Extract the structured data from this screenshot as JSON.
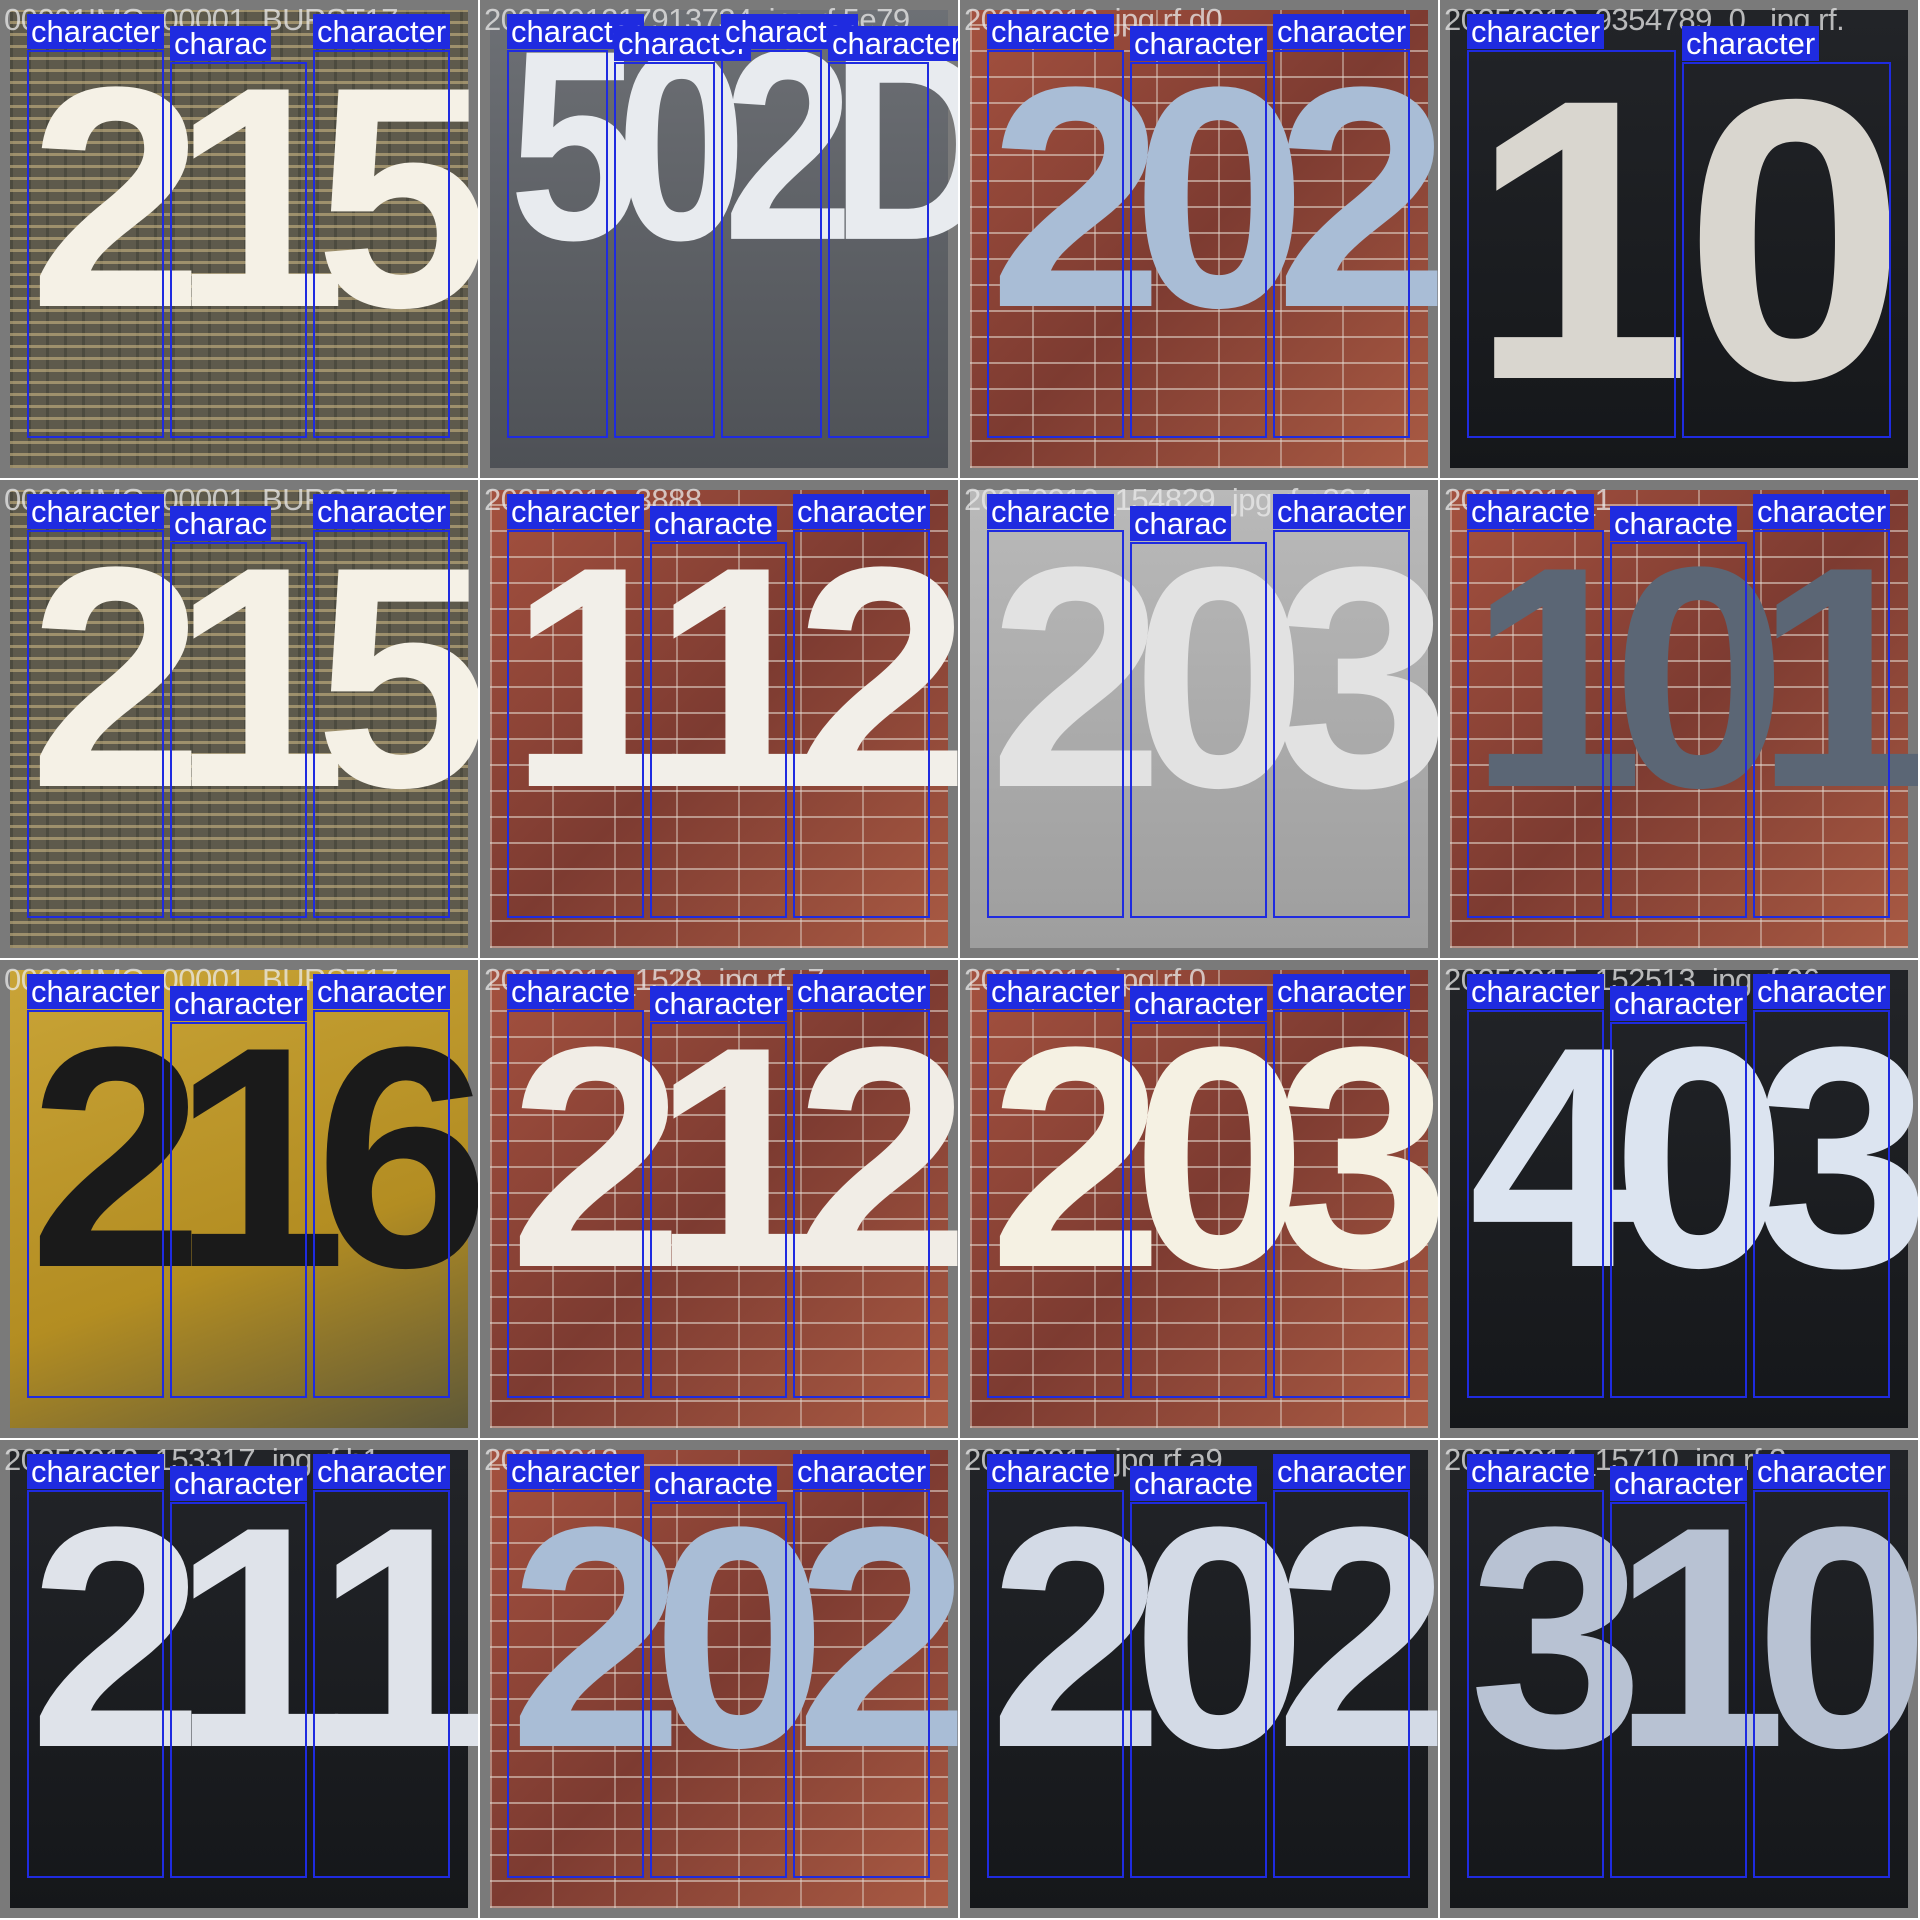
{
  "grid": {
    "columns": 4,
    "rows": 4,
    "box_color": "#1f2be0",
    "label_text": "character"
  },
  "tiles": [
    {
      "filename": "00001IMG_00001_BURST17",
      "digits": [
        "2",
        "1",
        "5"
      ],
      "background": "grille",
      "digit_color": "#f5f1e6",
      "labels": [
        "character",
        "charac",
        "character"
      ]
    },
    {
      "filename": "2025091217913734_jpg.rf.5e79",
      "digits": [
        "5",
        "0",
        "2",
        "D"
      ],
      "background": "glass",
      "digit_color": "#e8ebef",
      "labels": [
        "character",
        "character",
        "character",
        "character"
      ]
    },
    {
      "filename": "20250912_jpg.rf.d0",
      "digits": [
        "2",
        "0",
        "2"
      ],
      "background": "brick",
      "digit_color": "#a9bdd6",
      "labels": [
        "characte",
        "character",
        "character"
      ]
    },
    {
      "filename": "20250912_9354789_0_.jpg.rf.",
      "digits": [
        "1",
        "0"
      ],
      "background": "dark",
      "digit_color": "#d9d6cf",
      "labels": [
        "character",
        "character"
      ]
    },
    {
      "filename": "00001IMG_00001_BURST17",
      "digits": [
        "2",
        "1",
        "5"
      ],
      "background": "grille",
      "digit_color": "#f5f1e6",
      "labels": [
        "character",
        "charac",
        "character"
      ]
    },
    {
      "filename": "20250912_3888",
      "digits": [
        "1",
        "1",
        "2"
      ],
      "background": "brick",
      "digit_color": "#f2efe9",
      "labels": [
        "character",
        "characte",
        "character"
      ]
    },
    {
      "filename": "20250912_154829_jpg.rf.e394",
      "digits": [
        "2",
        "0",
        "3"
      ],
      "background": "fog",
      "digit_color": "#e2e2e2",
      "labels": [
        "characte",
        "charac",
        "character"
      ]
    },
    {
      "filename": "20250912_1",
      "digits": [
        "1",
        "0",
        "1"
      ],
      "background": "brick",
      "digit_color": "#5b6675",
      "labels": [
        "characte",
        "characte",
        "character"
      ]
    },
    {
      "filename": "00001IMG_00001_BURST17",
      "digits": [
        "2",
        "1",
        "6"
      ],
      "background": "yellow",
      "digit_color": "#1a1a1a",
      "labels": [
        "character",
        "character",
        "character"
      ]
    },
    {
      "filename": "20250912_1528_jpg.rf.c7",
      "digits": [
        "2",
        "1",
        "2"
      ],
      "background": "brick",
      "digit_color": "#f1ede6",
      "labels": [
        "characte",
        "character",
        "character"
      ]
    },
    {
      "filename": "20250912_jpg.rf.0",
      "digits": [
        "2",
        "0",
        "3"
      ],
      "background": "brick",
      "digit_color": "#f5f1e3",
      "labels": [
        "character",
        "character",
        "character"
      ]
    },
    {
      "filename": "20250915_152513_jpg.rf.06",
      "digits": [
        "4",
        "0",
        "3"
      ],
      "background": "dark",
      "digit_color": "#dce4f0",
      "labels": [
        "character",
        "character",
        "character"
      ]
    },
    {
      "filename": "20250912_153317_jpg.rf.b1",
      "digits": [
        "2",
        "1",
        "1"
      ],
      "background": "dark",
      "digit_color": "#dfe3ea",
      "labels": [
        "character",
        "character",
        "character"
      ]
    },
    {
      "filename": "20250912",
      "digits": [
        "2",
        "0",
        "2"
      ],
      "background": "brick",
      "digit_color": "#a9bdd6",
      "labels": [
        "character",
        "characte",
        "character"
      ]
    },
    {
      "filename": "20250915_jpg.rf.a9",
      "digits": [
        "2",
        "0",
        "2"
      ],
      "background": "dark",
      "digit_color": "#d3dae6",
      "labels": [
        "characte",
        "characte",
        "character"
      ]
    },
    {
      "filename": "20250914_15710_jpg.rf.3",
      "digits": [
        "3",
        "1",
        "0"
      ],
      "background": "dark",
      "digit_color": "#b8c2d3",
      "labels": [
        "characte",
        "character",
        "character"
      ]
    }
  ]
}
